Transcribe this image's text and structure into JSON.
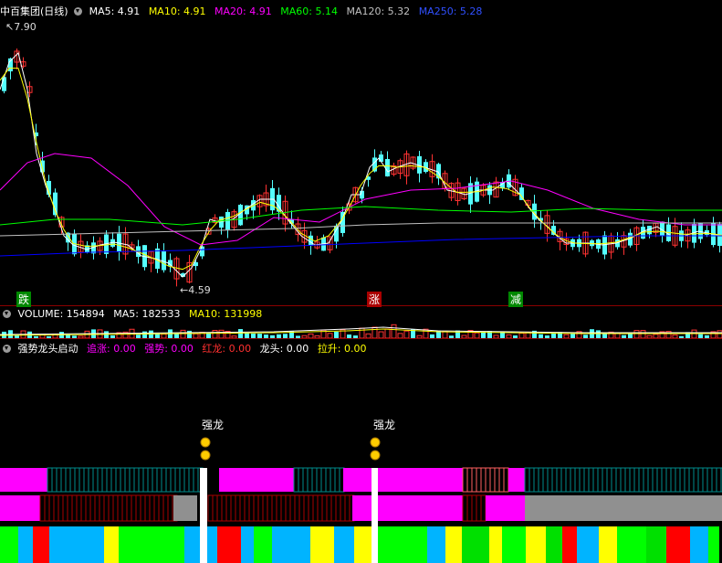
{
  "main_header": {
    "title": "中百集团(日线)",
    "ma5": "MA5: 4.91",
    "ma10": "MA10: 4.91",
    "ma20": "MA20: 4.91",
    "ma60": "MA60: 5.14",
    "ma120": "MA120: 5.32",
    "ma250": "MA250: 5.28"
  },
  "price_labels": {
    "high": "7.90",
    "low": "4.59"
  },
  "signals": [
    "跌",
    "涨",
    "减"
  ],
  "volume_header": {
    "volume": "VOLUME: 154894",
    "ma5": "MA5: 182533",
    "ma10": "MA10: 131998"
  },
  "indicator_header": {
    "title": "强势龙头启动",
    "zhuizhang": "追涨: 0.00",
    "qiangshi": "强势: 0.00",
    "honglong": "红龙: 0.00",
    "longtou": "龙头: 0.00",
    "lasheng": "拉升: 0.00"
  },
  "strong_dragon_label": "强龙",
  "colors": {
    "bg": "#000000",
    "ma5": "#ffffff",
    "ma10": "#ffff00",
    "ma20": "#ff00ff",
    "ma60": "#00ff00",
    "ma120": "#c0c0c0",
    "ma250": "#0000ff",
    "up": "#ff3232",
    "down": "#54ffff",
    "magenta": "#ff00ff",
    "gray": "#909090"
  }
}
